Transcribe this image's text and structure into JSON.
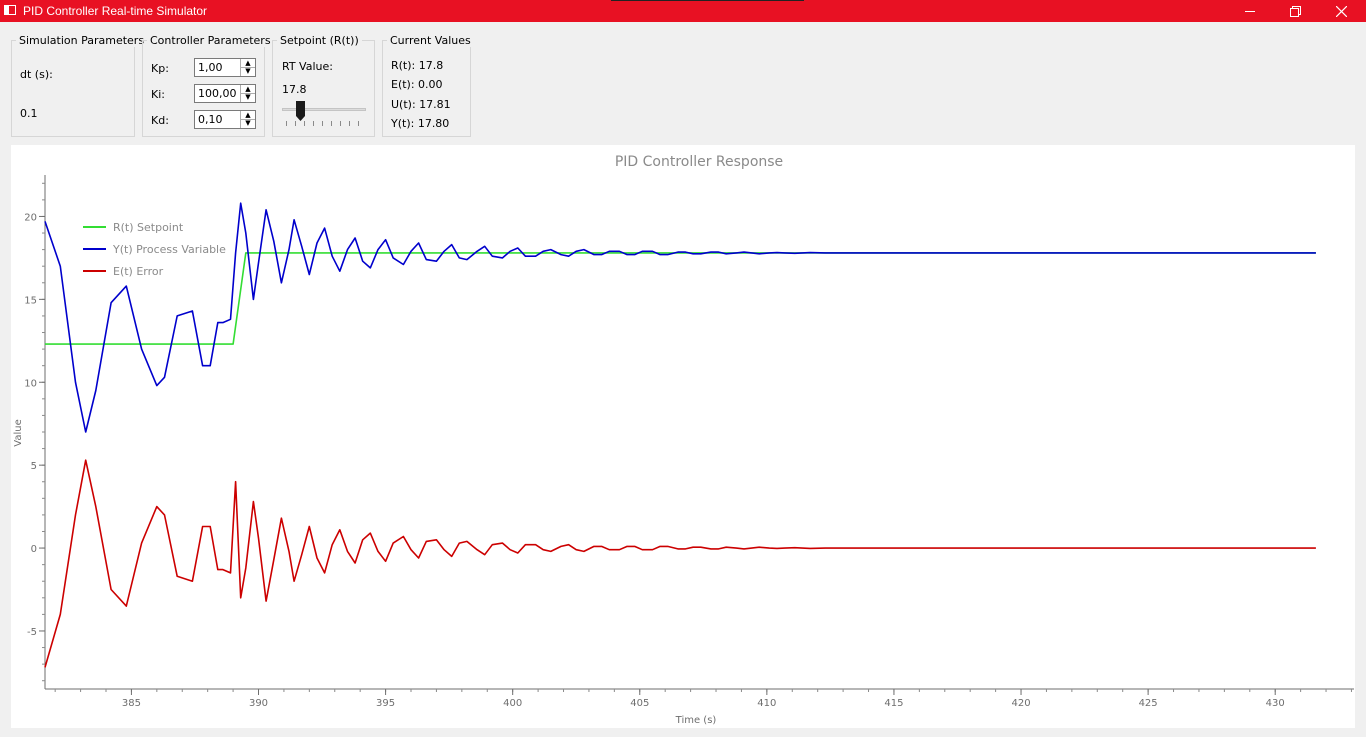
{
  "window": {
    "title": "PID Controller Real-time Simulator",
    "minimize_icon": "minimize-icon",
    "maximize_icon": "restore-icon",
    "close_icon": "close-icon",
    "accent": "#e81123"
  },
  "sim_params": {
    "title": "Simulation Parameters",
    "dt_label": "dt (s):",
    "dt_value": "0.1"
  },
  "controller": {
    "title": "Controller Parameters",
    "kp_label": "Kp:",
    "kp_value": "1,00",
    "ki_label": "Ki:",
    "ki_value": "100,00",
    "kd_label": "Kd:",
    "kd_value": "0,10"
  },
  "setpoint": {
    "title": "Setpoint (R(t))",
    "rt_label": "RT Value:",
    "rt_value": "17.8",
    "slider_fraction": 0.18
  },
  "current": {
    "title": "Current Values",
    "r": "R(t): 17.8",
    "e": "E(t): 0.00",
    "u": "U(t): 17.81",
    "y": "Y(t): 17.80"
  },
  "chart_data": {
    "type": "line",
    "title": "PID Controller Response",
    "xlabel": "Time (s)",
    "ylabel": "Value",
    "xlim": [
      381.6,
      433.1
    ],
    "ylim": [
      -8.5,
      22.5
    ],
    "xticks": [
      385,
      390,
      395,
      400,
      405,
      410,
      415,
      420,
      425,
      430
    ],
    "yticks": [
      -5,
      0,
      5,
      10,
      15,
      20
    ],
    "grid": false,
    "legend": "top-left",
    "series": [
      {
        "name": "R(t) Setpoint",
        "color": "#33dd33",
        "x": [
          381.6,
          389.0,
          389.5,
          431.6
        ],
        "y": [
          12.3,
          12.3,
          17.8,
          17.8
        ]
      },
      {
        "name": "Y(t) Process Variable",
        "color": "#0000cc",
        "x": [
          381.6,
          382.2,
          382.8,
          383.2,
          383.6,
          384.2,
          384.8,
          385.4,
          386.0,
          386.3,
          386.8,
          387.4,
          387.8,
          388.1,
          388.4,
          388.6,
          388.9,
          389.1,
          389.3,
          389.5,
          389.8,
          390.0,
          390.3,
          390.6,
          390.9,
          391.2,
          391.4,
          391.7,
          392.0,
          392.3,
          392.6,
          392.9,
          393.2,
          393.5,
          393.8,
          394.1,
          394.4,
          394.7,
          395.0,
          395.3,
          395.7,
          396.0,
          396.3,
          396.6,
          397.0,
          397.3,
          397.6,
          397.9,
          398.2,
          398.6,
          398.9,
          399.2,
          399.6,
          399.9,
          400.2,
          400.5,
          400.9,
          401.2,
          401.5,
          401.9,
          402.2,
          402.5,
          402.8,
          403.2,
          403.5,
          403.8,
          404.2,
          404.5,
          404.8,
          405.1,
          405.5,
          405.8,
          406.1,
          406.5,
          406.8,
          407.1,
          407.4,
          407.8,
          408.1,
          408.4,
          408.8,
          409.1,
          409.4,
          409.7,
          410.1,
          410.4,
          410.7,
          411.1,
          411.4,
          411.7,
          412.3,
          413.0,
          414.0,
          415.0,
          431.6
        ],
        "y": [
          19.7,
          17.0,
          10.0,
          7.0,
          9.5,
          14.8,
          15.8,
          12.0,
          9.8,
          10.3,
          14.0,
          14.3,
          11.0,
          11.0,
          13.6,
          13.6,
          13.8,
          17.8,
          20.8,
          19.0,
          15.0,
          17.2,
          20.4,
          18.5,
          16.0,
          18.0,
          19.8,
          18.2,
          16.5,
          18.4,
          19.3,
          17.6,
          16.7,
          18.0,
          18.7,
          17.3,
          16.9,
          18.0,
          18.6,
          17.5,
          17.1,
          17.9,
          18.4,
          17.4,
          17.3,
          17.9,
          18.3,
          17.5,
          17.4,
          17.9,
          18.2,
          17.6,
          17.5,
          17.9,
          18.1,
          17.6,
          17.6,
          17.9,
          18.0,
          17.7,
          17.6,
          17.9,
          18.0,
          17.7,
          17.7,
          17.9,
          17.9,
          17.7,
          17.7,
          17.9,
          17.9,
          17.7,
          17.7,
          17.85,
          17.85,
          17.75,
          17.75,
          17.85,
          17.85,
          17.75,
          17.8,
          17.85,
          17.8,
          17.75,
          17.8,
          17.82,
          17.8,
          17.78,
          17.8,
          17.82,
          17.8,
          17.8,
          17.8,
          17.8,
          17.8
        ]
      },
      {
        "name": "E(t) Error",
        "color": "#cc0000",
        "x": [
          381.6,
          382.2,
          382.8,
          383.2,
          383.6,
          384.2,
          384.8,
          385.4,
          386.0,
          386.3,
          386.8,
          387.4,
          387.8,
          388.1,
          388.4,
          388.6,
          388.9,
          389.1,
          389.3,
          389.5,
          389.8,
          390.0,
          390.3,
          390.6,
          390.9,
          391.2,
          391.4,
          391.7,
          392.0,
          392.3,
          392.6,
          392.9,
          393.2,
          393.5,
          393.8,
          394.1,
          394.4,
          394.7,
          395.0,
          395.3,
          395.7,
          396.0,
          396.3,
          396.6,
          397.0,
          397.3,
          397.6,
          397.9,
          398.2,
          398.6,
          398.9,
          399.2,
          399.6,
          399.9,
          400.2,
          400.5,
          400.9,
          401.2,
          401.5,
          401.9,
          402.2,
          402.5,
          402.8,
          403.2,
          403.5,
          403.8,
          404.2,
          404.5,
          404.8,
          405.1,
          405.5,
          405.8,
          406.1,
          406.5,
          406.8,
          407.1,
          407.4,
          407.8,
          408.1,
          408.4,
          408.8,
          409.1,
          409.4,
          409.7,
          410.1,
          410.4,
          410.7,
          411.1,
          411.4,
          411.7,
          412.3,
          413.0,
          414.0,
          415.0,
          431.6
        ],
        "y": [
          -7.2,
          -4.0,
          2.0,
          5.3,
          2.5,
          -2.5,
          -3.5,
          0.3,
          2.5,
          2.0,
          -1.7,
          -2.0,
          1.3,
          1.3,
          -1.3,
          -1.3,
          -1.5,
          4.0,
          -3.0,
          -1.2,
          2.8,
          0.6,
          -3.2,
          -0.7,
          1.8,
          -0.2,
          -2.0,
          -0.4,
          1.3,
          -0.6,
          -1.5,
          0.2,
          1.1,
          -0.2,
          -0.9,
          0.5,
          0.9,
          -0.2,
          -0.8,
          0.3,
          0.7,
          -0.1,
          -0.6,
          0.4,
          0.5,
          -0.1,
          -0.5,
          0.3,
          0.4,
          -0.1,
          -0.4,
          0.2,
          0.3,
          -0.1,
          -0.3,
          0.2,
          0.2,
          -0.1,
          -0.2,
          0.1,
          0.2,
          -0.1,
          -0.2,
          0.1,
          0.1,
          -0.1,
          -0.1,
          0.1,
          0.1,
          -0.1,
          -0.1,
          0.1,
          0.1,
          -0.05,
          -0.05,
          0.05,
          0.05,
          -0.05,
          -0.05,
          0.05,
          0.0,
          -0.05,
          0.0,
          0.05,
          0.0,
          -0.02,
          0.0,
          0.02,
          0.0,
          -0.02,
          0.0,
          0.0,
          0.0,
          0.0,
          0.0
        ]
      }
    ]
  }
}
